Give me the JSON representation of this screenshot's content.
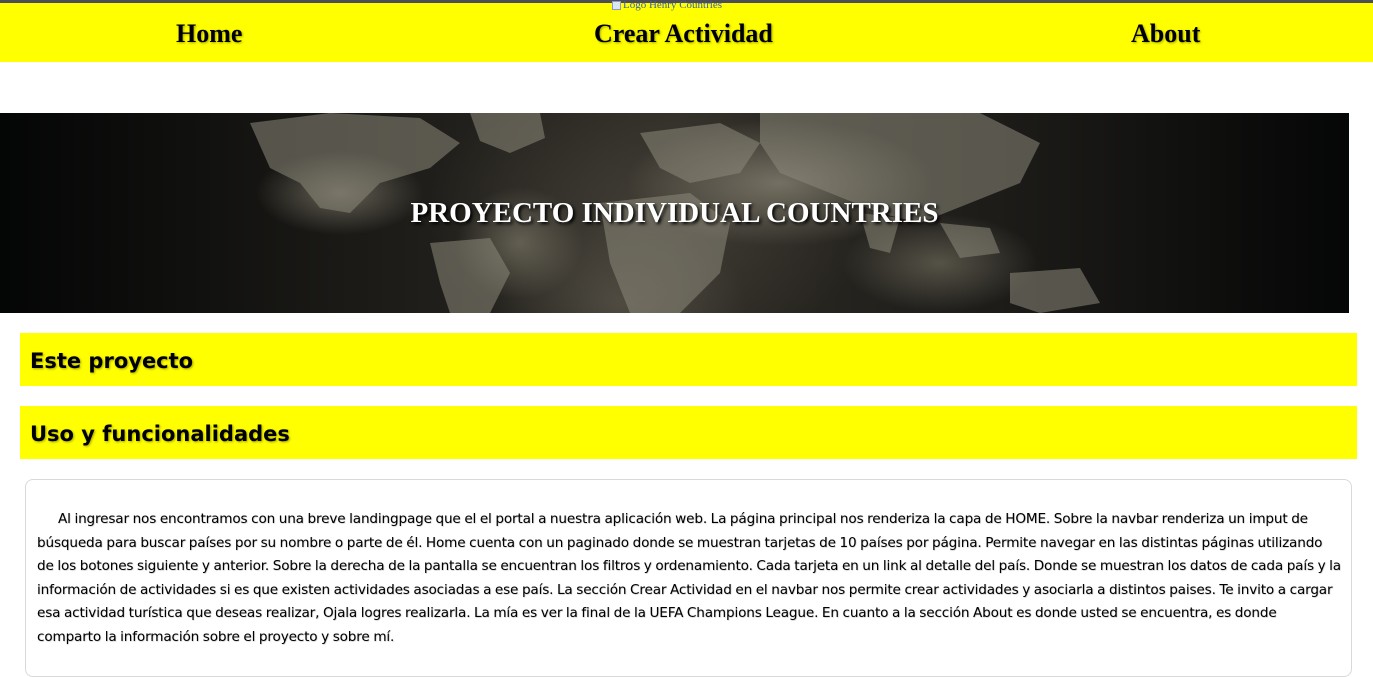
{
  "navbar": {
    "logo_alt": "Logo Henry Countries",
    "links": [
      {
        "label": "Home"
      },
      {
        "label": "Crear Actividad"
      },
      {
        "label": "About"
      }
    ],
    "background_color": "#ffff00"
  },
  "banner": {
    "title": "PROYECTO INDIVIDUAL COUNTRIES"
  },
  "sections": [
    {
      "label": "Este proyecto"
    },
    {
      "label": "Uso y funcionalidades"
    }
  ],
  "description": "Al ingresar nos encontramos con una breve landingpage que el el portal a nuestra aplicación web. La página principal nos renderiza la capa de HOME. Sobre la navbar renderiza un imput de búsqueda para buscar países por su nombre o parte de él. Home cuenta con un paginado donde se muestran tarjetas de 10 países por página. Permite navegar en las distintas páginas utilizando de los botones siguiente y anterior. Sobre la derecha de la pantalla se encuentran los filtros y ordenamiento. Cada tarjeta en un link al detalle del país. Donde se muestran los datos de cada país y la información de actividades si es que existen actividades asociadas a ese país. La sección Crear Actividad en el navbar nos permite crear actividades y asociarla a distintos paises. Te invito a cargar esa actividad turística que deseas realizar, Ojala logres realizarla. La mía es ver la final de la UEFA Champions League. En cuanto a la sección About es donde usted se encuentra, es donde comparto la información sobre el proyecto y sobre mí."
}
